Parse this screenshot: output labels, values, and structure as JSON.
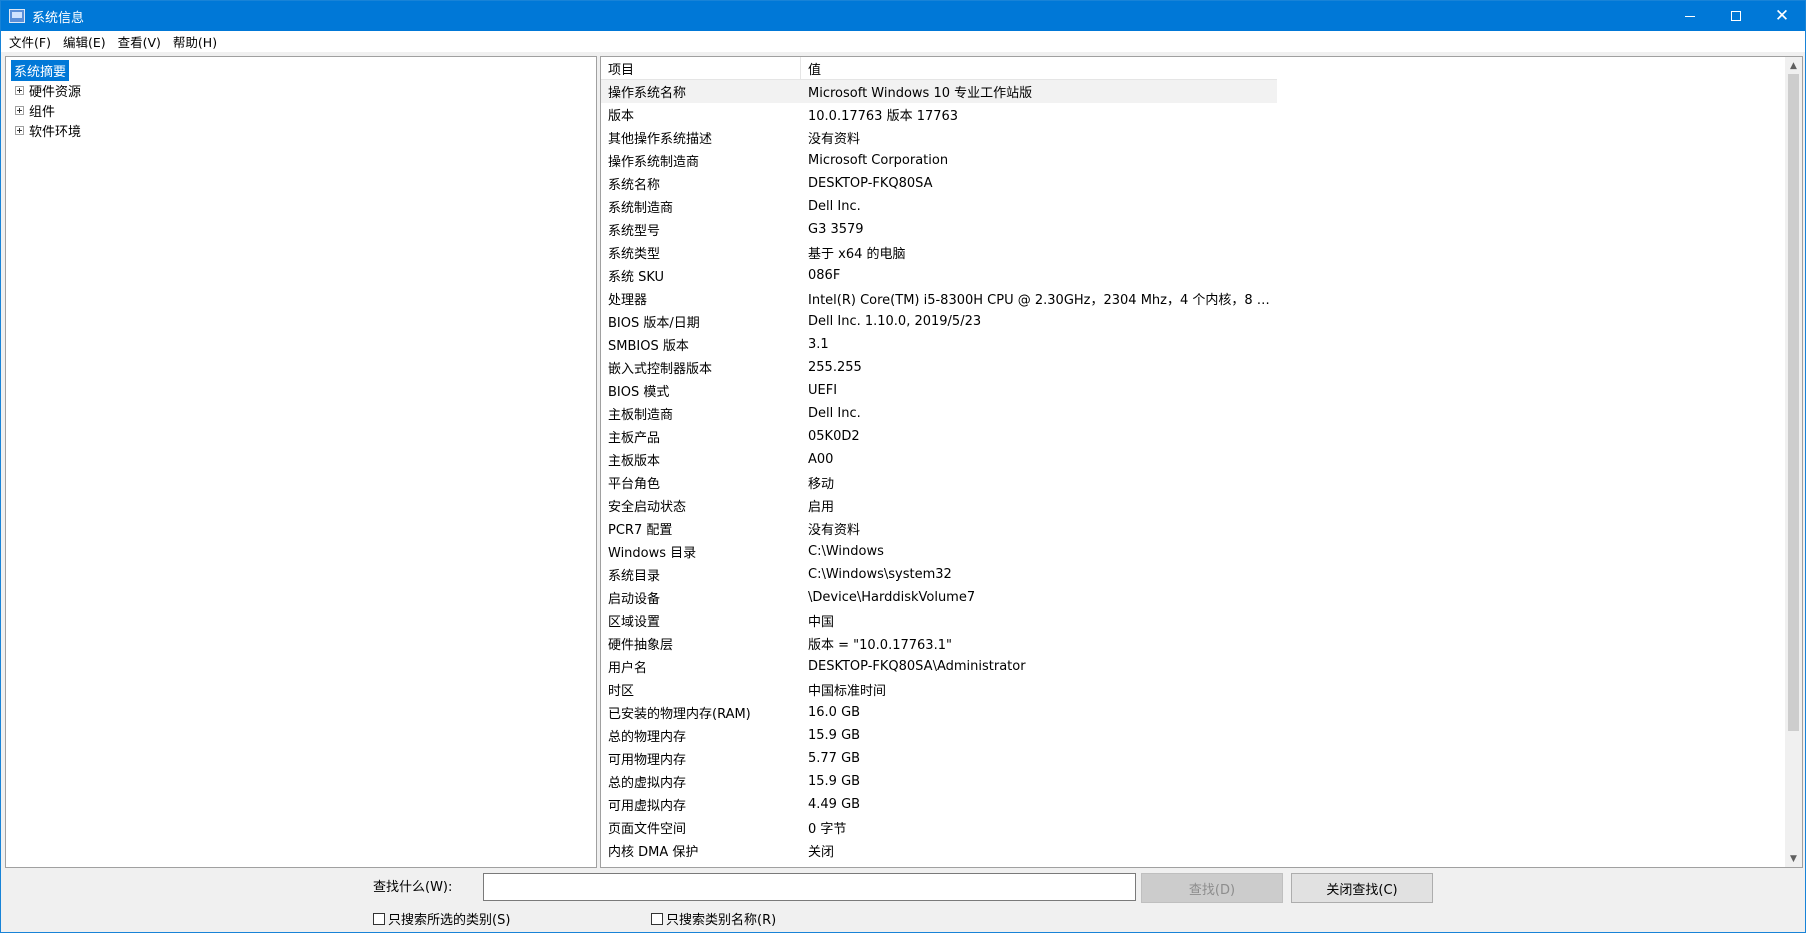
{
  "window": {
    "title": "系统信息",
    "controls": {
      "minimize": "minimize",
      "maximize": "maximize",
      "close": "✕"
    }
  },
  "menu": [
    {
      "label": "文件(F)"
    },
    {
      "label": "编辑(E)"
    },
    {
      "label": "查看(V)"
    },
    {
      "label": "帮助(H)"
    }
  ],
  "tree": {
    "root": "系统摘要",
    "children": [
      {
        "label": "硬件资源"
      },
      {
        "label": "组件"
      },
      {
        "label": "软件环境"
      }
    ]
  },
  "table": {
    "headers": {
      "item": "项目",
      "value": "值"
    },
    "rows": [
      {
        "k": "操作系统名称",
        "v": "Microsoft Windows 10 专业工作站版"
      },
      {
        "k": "版本",
        "v": "10.0.17763 版本 17763"
      },
      {
        "k": "其他操作系统描述",
        "v": "没有资料"
      },
      {
        "k": "操作系统制造商",
        "v": "Microsoft Corporation"
      },
      {
        "k": "系统名称",
        "v": "DESKTOP-FKQ80SA"
      },
      {
        "k": "系统制造商",
        "v": "Dell Inc."
      },
      {
        "k": "系统型号",
        "v": "G3 3579"
      },
      {
        "k": "系统类型",
        "v": "基于 x64 的电脑"
      },
      {
        "k": "系统 SKU",
        "v": "086F"
      },
      {
        "k": "处理器",
        "v": "Intel(R) Core(TM) i5-8300H CPU @ 2.30GHz，2304 Mhz，4 个内核，8 个..."
      },
      {
        "k": "BIOS 版本/日期",
        "v": "Dell Inc. 1.10.0, 2019/5/23"
      },
      {
        "k": "SMBIOS 版本",
        "v": "3.1"
      },
      {
        "k": "嵌入式控制器版本",
        "v": "255.255"
      },
      {
        "k": "BIOS 模式",
        "v": "UEFI"
      },
      {
        "k": "主板制造商",
        "v": "Dell Inc."
      },
      {
        "k": "主板产品",
        "v": "05K0D2"
      },
      {
        "k": "主板版本",
        "v": "A00"
      },
      {
        "k": "平台角色",
        "v": "移动"
      },
      {
        "k": "安全启动状态",
        "v": "启用"
      },
      {
        "k": "PCR7 配置",
        "v": "没有资料"
      },
      {
        "k": "Windows 目录",
        "v": "C:\\Windows"
      },
      {
        "k": "系统目录",
        "v": "C:\\Windows\\system32"
      },
      {
        "k": "启动设备",
        "v": "\\Device\\HarddiskVolume7"
      },
      {
        "k": "区域设置",
        "v": "中国"
      },
      {
        "k": "硬件抽象层",
        "v": "版本 = \"10.0.17763.1\""
      },
      {
        "k": "用户名",
        "v": "DESKTOP-FKQ80SA\\Administrator"
      },
      {
        "k": "时区",
        "v": "中国标准时间"
      },
      {
        "k": "已安装的物理内存(RAM)",
        "v": "16.0 GB"
      },
      {
        "k": "总的物理内存",
        "v": "15.9 GB"
      },
      {
        "k": "可用物理内存",
        "v": "5.77 GB"
      },
      {
        "k": "总的虚拟内存",
        "v": "15.9 GB"
      },
      {
        "k": "可用虚拟内存",
        "v": "4.49 GB"
      },
      {
        "k": "页面文件空间",
        "v": "0 字节"
      },
      {
        "k": "内核 DMA 保护",
        "v": "关闭"
      }
    ]
  },
  "find": {
    "label": "查找什么(W):",
    "value": "",
    "find_button": "查找(D)",
    "close_button": "关闭查找(C)",
    "option_selected_category": "只搜索所选的类别(S)",
    "option_category_names": "只搜索类别名称(R)"
  },
  "scroll": {
    "up": "▲",
    "down": "▼"
  }
}
